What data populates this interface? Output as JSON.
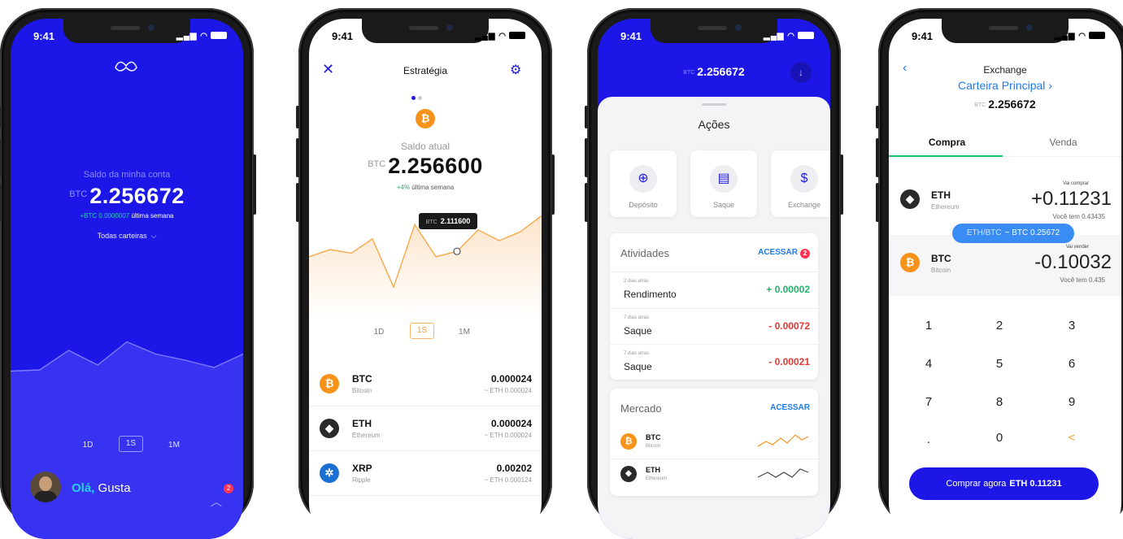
{
  "status_time": "9:41",
  "screen1": {
    "balance_label": "Saldo da minha conta",
    "balance_currency": "BTC",
    "balance_value": "2.256672",
    "delta_value": "+BTC 0.0000007",
    "delta_period": "última semana",
    "wallet_selector": "Todas carteiras",
    "periods": [
      "1D",
      "1S",
      "1M"
    ],
    "selected_period": "1S",
    "greeting_hi": "Olá,",
    "greeting_name": "Gusta",
    "notification_count": "2",
    "chart_values": [
      31,
      32,
      48,
      36,
      55,
      45,
      40,
      34,
      45
    ]
  },
  "screen2": {
    "title": "Estratégia",
    "balance_label": "Saldo atual",
    "balance_currency": "BTC",
    "balance_value": "2.256600",
    "delta_value": "+4%",
    "delta_period": "última semana",
    "tooltip_currency": "BTC",
    "tooltip_value": "2.111600",
    "periods": [
      "1D",
      "1S",
      "1M"
    ],
    "selected_period": "1S",
    "chart_values": [
      52,
      60,
      56,
      72,
      18,
      88,
      52,
      58,
      82,
      70,
      80,
      98
    ],
    "assets": [
      {
        "symbol": "BTC",
        "name": "Bitcoin",
        "amount": "0.000024",
        "sub": "~ ETH 0.000024",
        "icon": "bitcoin-icon"
      },
      {
        "symbol": "ETH",
        "name": "Ethereum",
        "amount": "0.000024",
        "sub": "~ ETH 0.000024",
        "icon": "ethereum-icon"
      },
      {
        "symbol": "XRP",
        "name": "Ripple",
        "amount": "0.00202",
        "sub": "~ ETH 0.000124",
        "icon": "ripple-icon"
      }
    ]
  },
  "screen3": {
    "balance_currency": "BTC",
    "balance_value": "2.256672",
    "sheet_title": "Ações",
    "actions": [
      "Depósito",
      "Saque",
      "Exchange"
    ],
    "activities_title": "Atividades",
    "activities_link": "ACESSAR",
    "activities_badge": "2",
    "activities": [
      {
        "time": "2 dias atrás",
        "name": "Rendimento",
        "value": "+ 0.00002",
        "positive": true
      },
      {
        "time": "7 dias atrás",
        "name": "Saque",
        "value": "- 0.00072",
        "positive": false
      },
      {
        "time": "7 dias atrás",
        "name": "Saque",
        "value": "- 0.00021",
        "positive": false
      }
    ],
    "market_title": "Mercado",
    "market_link": "ACESSAR",
    "market": [
      {
        "symbol": "BTC",
        "name": "Bitcoin"
      },
      {
        "symbol": "ETH",
        "name": "Ethereum"
      }
    ],
    "colors": {
      "positive": "#20b46a",
      "negative": "#e53935"
    }
  },
  "screen4": {
    "title": "Exchange",
    "wallet": "Carteira Principal ›",
    "balance_currency": "BTC",
    "balance_value": "2.256672",
    "tab_buy": "Compra",
    "tab_sell": "Venda",
    "buy": {
      "label": "Vai comprar",
      "symbol": "ETH",
      "name": "Ethereum",
      "value": "+0.11231",
      "have": "Você tem 0.43435"
    },
    "rate_pair": "ETH/BTC",
    "rate_value": "~ BTC 0.25672",
    "sell": {
      "label": "Vai vender",
      "symbol": "BTC",
      "name": "Bitcoin",
      "value": "-0.10032",
      "have": "Você tem 0.435"
    },
    "keys": [
      "1",
      "2",
      "3",
      "4",
      "5",
      "6",
      "7",
      "8",
      "9",
      ".",
      "0",
      "<"
    ],
    "cta_label": "Comprar agora",
    "cta_amount": "ETH 0.11231"
  }
}
